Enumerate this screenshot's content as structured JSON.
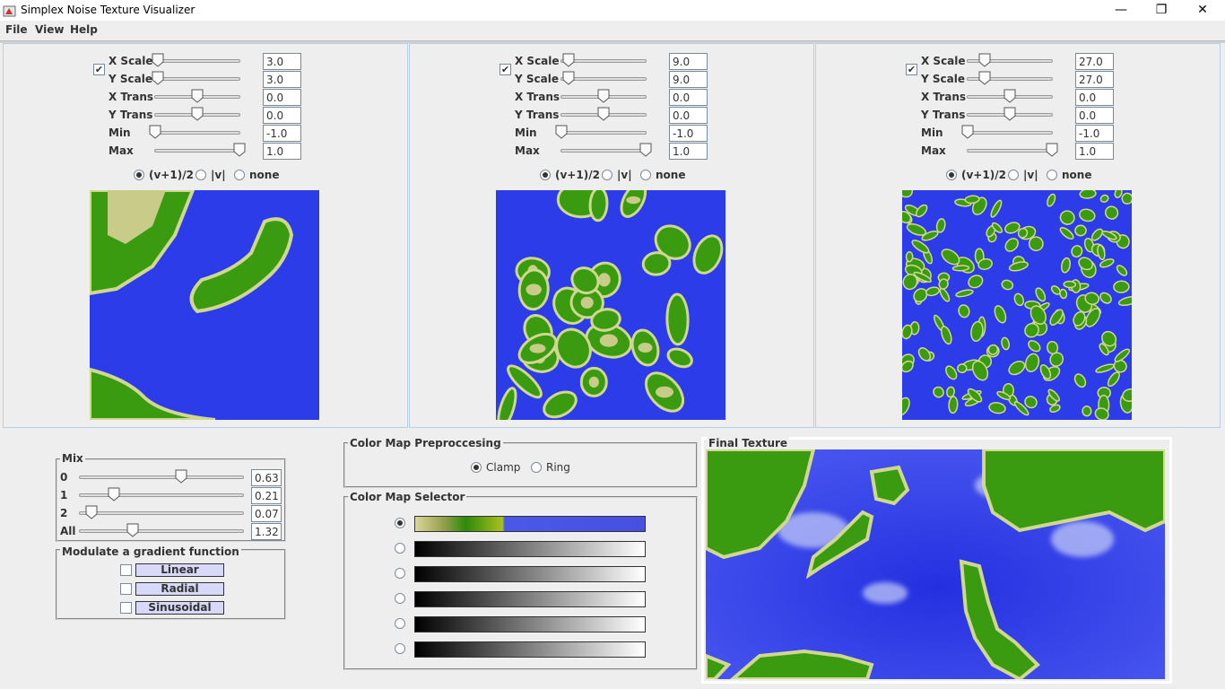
{
  "window": {
    "title": "Simplex Noise Texture Visualizer",
    "minimize": "—",
    "maximize": "❐",
    "close": "✕"
  },
  "menu": [
    "File",
    "View",
    "Help"
  ],
  "slider_labels": [
    "X Scale",
    "Y Scale",
    "X Trans",
    "Y Trans",
    "Min",
    "Max"
  ],
  "panels": [
    {
      "checked": true,
      "values": [
        "3.0",
        "3.0",
        "0.0",
        "0.0",
        "-1.0",
        "1.0"
      ],
      "slider_fraction": [
        0.03,
        0.03,
        0.5,
        0.5,
        0.0,
        1.0
      ]
    },
    {
      "checked": true,
      "values": [
        "9.0",
        "9.0",
        "0.0",
        "0.0",
        "-1.0",
        "1.0"
      ],
      "slider_fraction": [
        0.09,
        0.09,
        0.5,
        0.5,
        0.0,
        1.0
      ]
    },
    {
      "checked": true,
      "values": [
        "27.0",
        "27.0",
        "0.0",
        "0.0",
        "-1.0",
        "1.0"
      ],
      "slider_fraction": [
        0.2,
        0.2,
        0.5,
        0.5,
        0.0,
        1.0
      ]
    }
  ],
  "mode_options": [
    "(v+1)/2",
    "|v|",
    "none"
  ],
  "mode_selected": 0,
  "mix": {
    "title": "Mix",
    "rows": [
      {
        "label": "0",
        "value": "0.63",
        "fraction": 0.63
      },
      {
        "label": "1",
        "value": "0.21",
        "fraction": 0.21
      },
      {
        "label": "2",
        "value": "0.07",
        "fraction": 0.07
      },
      {
        "label": "All",
        "value": "1.32",
        "fraction": 0.33
      }
    ]
  },
  "gradient": {
    "title": "Modulate a gradient function",
    "items": [
      "Linear",
      "Radial",
      "Sinusoidal"
    ]
  },
  "preprocessing": {
    "title": "Color Map Preproccesing",
    "options": [
      "Clamp",
      "Ring"
    ],
    "selected": 0
  },
  "selector": {
    "title": "Color Map Selector",
    "count": 6,
    "selected": 0
  },
  "final": {
    "title": "Final Texture"
  },
  "colors": {
    "blue": "#2c3ce8",
    "green": "#3a9a10",
    "sand": "#d8d898",
    "accent": "#b8cfe5"
  }
}
